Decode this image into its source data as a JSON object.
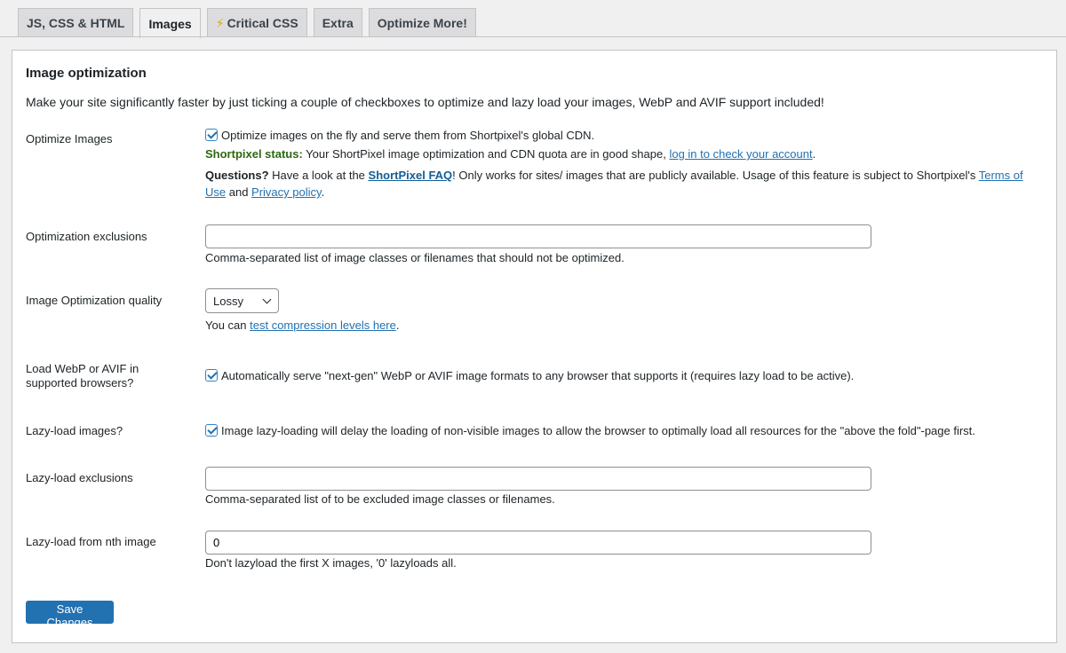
{
  "tabs": [
    {
      "label": "JS, CSS & HTML"
    },
    {
      "label": "Images"
    },
    {
      "label": "Critical CSS"
    },
    {
      "label": "Extra"
    },
    {
      "label": "Optimize More!"
    }
  ],
  "panel": {
    "title": "Image optimization",
    "intro": "Make your site significantly faster by just ticking a couple of checkboxes to optimize and lazy load your images, WebP and AVIF support included!"
  },
  "optimize_images": {
    "label": "Optimize Images",
    "checked": true,
    "checkbox_text": "Optimize images on the fly and serve them from Shortpixel's global CDN.",
    "status_label": "Shortpixel status:",
    "status_text": " Your ShortPixel image optimization and CDN quota are in good shape, ",
    "status_link": "log in to check your account",
    "status_end": ".",
    "questions_label": "Questions?",
    "questions_text1": " Have a look at the ",
    "faq_link": "ShortPixel FAQ",
    "questions_text2": "! Only works for sites/ images that are publicly available. Usage of this feature is subject to Shortpixel's ",
    "terms_link": "Terms of Use",
    "and_text": " and ",
    "privacy_link": "Privacy policy",
    "questions_end": "."
  },
  "optimization_exclusions": {
    "label": "Optimization exclusions",
    "value": "",
    "description": "Comma-separated list of image classes or filenames that should not be optimized."
  },
  "quality": {
    "label": "Image Optimization quality",
    "selected": "Lossy",
    "desc_prefix": "You can ",
    "desc_link": "test compression levels here",
    "desc_suffix": "."
  },
  "webp": {
    "label_line1": "Load WebP or AVIF in",
    "label_line2": "supported browsers?",
    "checked": true,
    "checkbox_text": "Automatically serve \"next-gen\" WebP or AVIF image formats to any browser that supports it (requires lazy load to be active)."
  },
  "lazyload": {
    "label": "Lazy-load images?",
    "checked": true,
    "checkbox_text": "Image lazy-loading will delay the loading of non-visible images to allow the browser to optimally load all resources for the \"above the fold\"-page first."
  },
  "lazyload_exclusions": {
    "label": "Lazy-load exclusions",
    "value": "",
    "description": "Comma-separated list of to be excluded image classes or filenames."
  },
  "lazyload_nth": {
    "label": "Lazy-load from nth image",
    "value": "0",
    "description": "Don't lazyload the first X images, '0' lazyloads all."
  },
  "save_label": "Save Changes"
}
